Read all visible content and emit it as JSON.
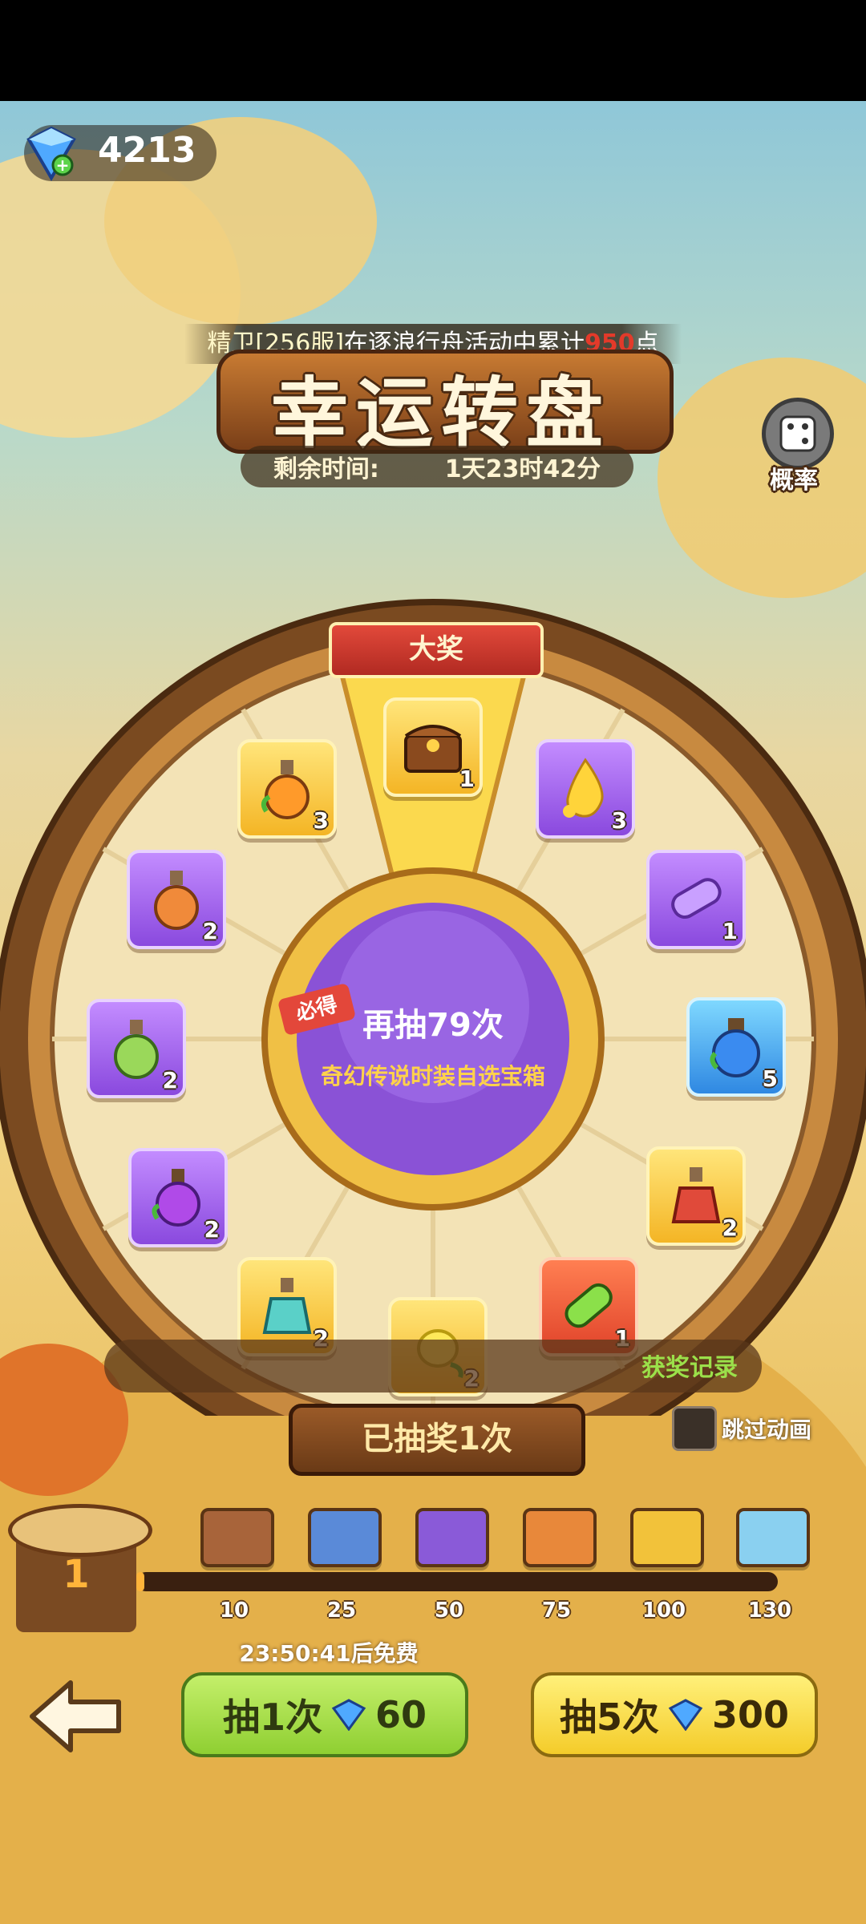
{
  "currency": {
    "icon": "diamond-icon",
    "amount": "4213"
  },
  "announcement": {
    "prefix": "精卫[256服]",
    "middle": "在逐浪行舟活动中累计",
    "points": "950",
    "suffix": "点"
  },
  "title": "幸运转盘",
  "timer": {
    "label": "剩余时间:",
    "value": "1天23时42分"
  },
  "probability": {
    "label": "概率",
    "icon": "dice-icon"
  },
  "wheel": {
    "grand_prize_label": "大奖",
    "center": {
      "badge": "必得",
      "draws": "再抽79次",
      "reward": "奇幻传说时装自选宝箱"
    },
    "items": [
      {
        "name": "treasure-chest",
        "count": "1",
        "rarity": "gold"
      },
      {
        "name": "golden-drop",
        "count": "3",
        "rarity": "purple"
      },
      {
        "name": "purple-tube",
        "count": "1",
        "rarity": "purple"
      },
      {
        "name": "blue-potion",
        "count": "5",
        "rarity": "blue"
      },
      {
        "name": "red-potion",
        "count": "2",
        "rarity": "gold"
      },
      {
        "name": "green-tube",
        "count": "1",
        "rarity": "red"
      },
      {
        "name": "yellow-seed",
        "count": "2",
        "rarity": "gold"
      },
      {
        "name": "cyan-potion",
        "count": "2",
        "rarity": "gold"
      },
      {
        "name": "purple-fruit-potion",
        "count": "2",
        "rarity": "purple"
      },
      {
        "name": "green-potion",
        "count": "2",
        "rarity": "purple"
      },
      {
        "name": "orange-potion",
        "count": "2",
        "rarity": "purple"
      },
      {
        "name": "orange-fruit-potion",
        "count": "3",
        "rarity": "gold"
      }
    ]
  },
  "records_label": "获奖记录",
  "draw_count_label": "已抽奖1次",
  "skip_animation": {
    "label": "跳过动画",
    "checked": false
  },
  "progress": {
    "current": "1",
    "milestones": [
      {
        "value": "10",
        "chest": "wood-chest"
      },
      {
        "value": "25",
        "chest": "blue-chest"
      },
      {
        "value": "50",
        "chest": "purple-chest"
      },
      {
        "value": "75",
        "chest": "orange-chest"
      },
      {
        "value": "100",
        "chest": "gold-chest"
      },
      {
        "value": "130",
        "chest": "crystal-chest"
      }
    ]
  },
  "free_timer": "23:50:41后免费",
  "buttons": {
    "back": "back-arrow-icon",
    "draw1": {
      "label": "抽1次",
      "cost": "60"
    },
    "draw5": {
      "label": "抽5次",
      "cost": "300"
    }
  },
  "colors": {
    "points_red": "#e33a2a",
    "green_btn": "#9fdc42",
    "yellow_btn": "#ffe04a"
  }
}
